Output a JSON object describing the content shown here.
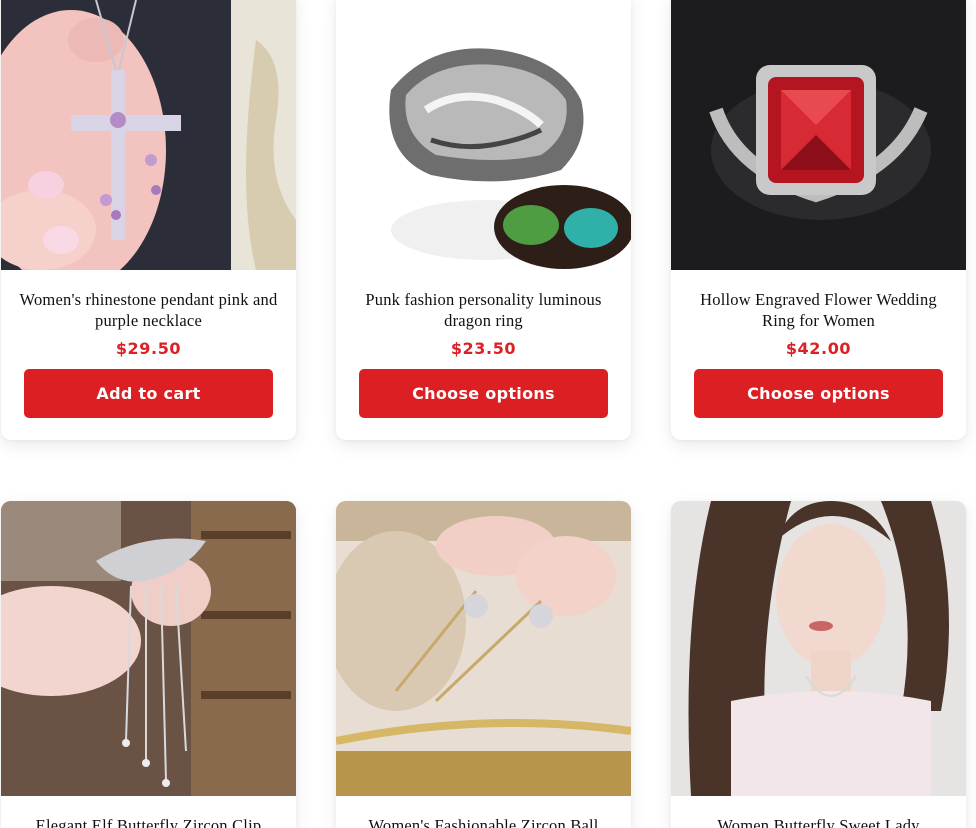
{
  "products": [
    {
      "title": "Women's rhinestone pendant pink and purple necklace",
      "price": "$29.50",
      "button": "Add to cart"
    },
    {
      "title": "Punk fashion personality luminous dragon ring",
      "price": "$23.50",
      "button": "Choose options"
    },
    {
      "title": "Hollow Engraved Flower Wedding Ring for Women",
      "price": "$42.00",
      "button": "Choose options"
    },
    {
      "title": "Elegant Elf Butterfly Zircon Clip"
    },
    {
      "title": "Women's Fashionable Zircon Ball"
    },
    {
      "title": "Women Butterfly Sweet Lady"
    }
  ],
  "colors": {
    "accent": "#dc1f22",
    "price": "#dc2025"
  }
}
